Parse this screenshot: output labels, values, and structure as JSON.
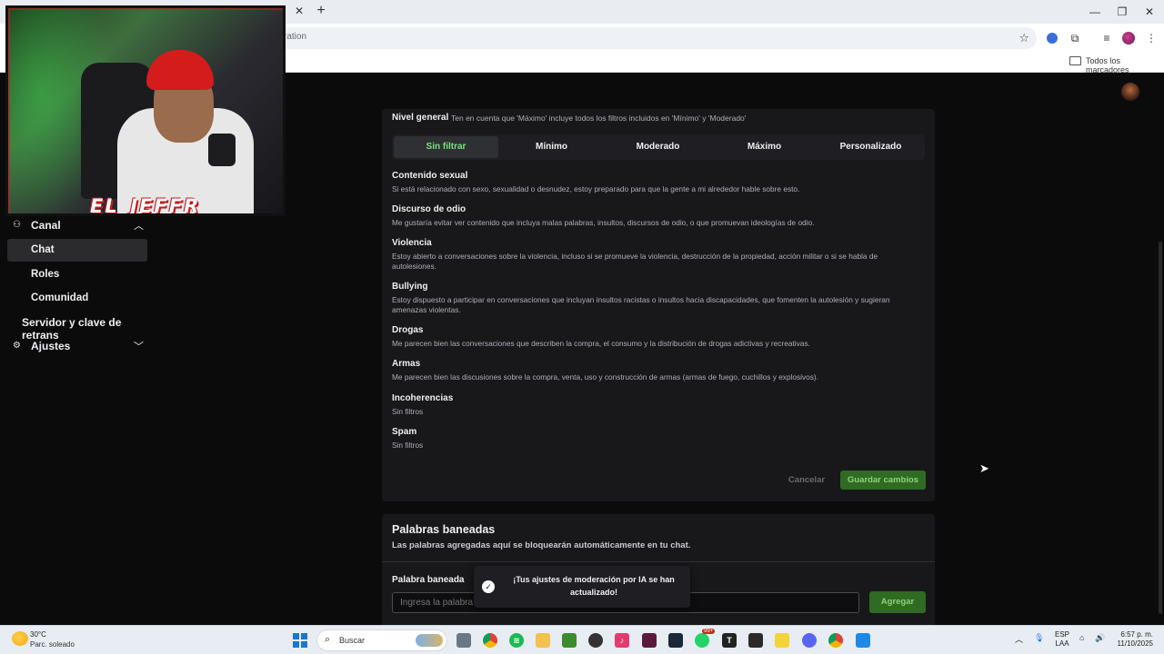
{
  "browser": {
    "omnibox_text": "ration",
    "bookmarks_folder": "Todos los marcadores"
  },
  "sidebar": {
    "canal_label": "Canal",
    "items": [
      {
        "label": "Chat"
      },
      {
        "label": "Roles"
      },
      {
        "label": "Comunidad"
      }
    ],
    "servidor_label": "Servidor y clave de retrans",
    "ajustes_label": "Ajustes"
  },
  "webcam": {
    "name": "EL_JEFFR"
  },
  "moderation": {
    "general_label": "Nivel general",
    "general_desc": "Ten en cuenta que 'Máximo' incluye todos los filtros incluidos en 'Mínimo' y 'Moderado'",
    "levels": [
      "Sin filtrar",
      "Mínimo",
      "Moderado",
      "Máximo",
      "Personalizado"
    ],
    "selected_level": "Sin filtrar",
    "categories": [
      {
        "title": "Contenido sexual",
        "desc": "Si está relacionado con sexo, sexualidad o desnudez, estoy preparado para que la gente a mi alrededor hable sobre esto."
      },
      {
        "title": "Discurso de odio",
        "desc": "Me gustaría evitar ver contenido que incluya malas palabras, insultos, discursos de odio, o que promuevan ideologías de odio."
      },
      {
        "title": "Violencia",
        "desc": "Estoy abierto a conversaciones sobre la violencia, incluso si se promueve la violencia, destrucción de la propiedad, acción militar o si se habla de autolesiones."
      },
      {
        "title": "Bullying",
        "desc": "Estoy dispuesto a participar en conversaciones que incluyan insultos racistas o insultos hacia discapacidades, que fomenten la autolesión y sugieran amenazas violentas."
      },
      {
        "title": "Drogas",
        "desc": "Me parecen bien las conversaciones que describen la compra, el consumo y la distribución de drogas adictivas y recreativas."
      },
      {
        "title": "Armas",
        "desc": "Me parecen bien las discusiones sobre la compra, venta, uso y construcción de armas (armas de fuego, cuchillos y explosivos)."
      },
      {
        "title": "Incoherencias",
        "desc": "Sin filtros"
      },
      {
        "title": "Spam",
        "desc": "Sin filtros"
      }
    ],
    "cancel_label": "Cancelar",
    "save_label": "Guardar cambios"
  },
  "banned_words": {
    "title": "Palabras baneadas",
    "desc": "Las palabras agregadas aquí se bloquearán automáticamente en tu chat.",
    "field_label": "Palabra baneada",
    "placeholder": "Ingresa la palabra",
    "add_label": "Agregar"
  },
  "toast": {
    "message": "¡Tus ajustes de moderación por IA se han actualizado!"
  },
  "taskbar": {
    "temp": "30°C",
    "weather": "Parc. soleado",
    "search": "Buscar",
    "lang_1": "ESP",
    "lang_2": "LAA",
    "time": "6:57 p. m.",
    "date": "11/10/2025",
    "badge_whatsapp": "99+"
  },
  "colors": {
    "accent_green": "#79e27c",
    "button_green": "#2f6b22",
    "panel_bg": "#18181b"
  }
}
